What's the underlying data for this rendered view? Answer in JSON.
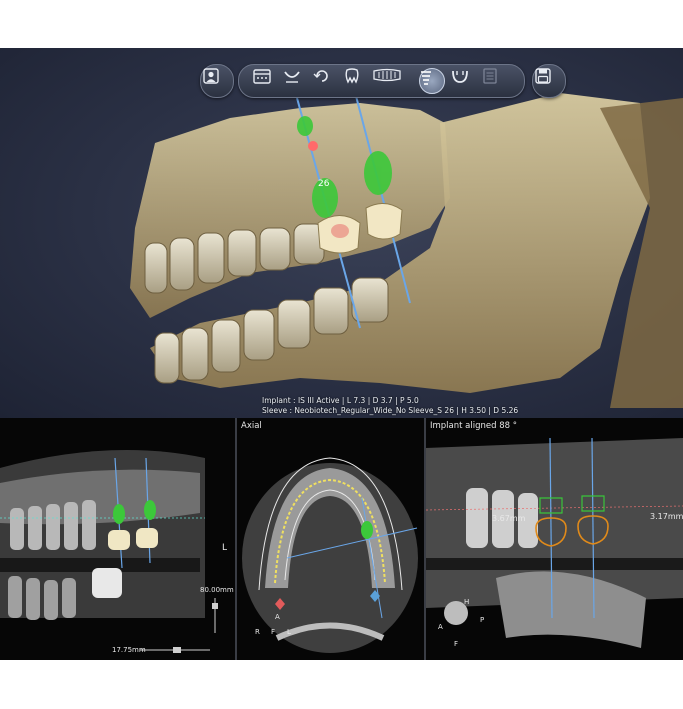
{
  "toolbar": {
    "groups": [
      {
        "name": "patient-group",
        "buttons": [
          {
            "icon": "patient-icon",
            "glyph": "👤"
          }
        ]
      },
      {
        "name": "tools-group",
        "buttons": [
          {
            "icon": "calendar-icon",
            "glyph": "▦"
          },
          {
            "icon": "arch-curve-icon",
            "glyph": "⌣"
          },
          {
            "icon": "rotate-icon",
            "glyph": "⟲"
          },
          {
            "icon": "tooth-icon",
            "glyph": "◌"
          },
          {
            "icon": "panoramic-icon",
            "glyph": "▭"
          },
          {
            "icon": "implant-icon",
            "glyph": "≡"
          },
          {
            "icon": "guide-icon",
            "glyph": "∪"
          },
          {
            "icon": "report-icon",
            "glyph": "▯"
          }
        ]
      },
      {
        "name": "save-group",
        "buttons": [
          {
            "icon": "save-icon",
            "glyph": "💾"
          }
        ]
      }
    ],
    "active": "implant-icon"
  },
  "view3d": {
    "implant_info": "Implant : IS III Active | L 7.3 | D 3.7 | P 5.0",
    "sleeve_info": "Sleeve : Neobiotech_Regular_Wide_No Sleeve_S 26 | H 3.50 | D 5.26",
    "tooth_label": "26"
  },
  "panels": {
    "left": {
      "orientation": "L",
      "depth_label": "80.00mm",
      "scale_label": "17.75mm"
    },
    "axial": {
      "title": "Axial",
      "labels": [
        "A",
        "R",
        "F",
        "L"
      ]
    },
    "cross": {
      "title": "Implant aligned 88 °",
      "left_measure": "3.67mm",
      "right_measure": "3.17mm",
      "labels": [
        "A",
        "H",
        "F",
        "P"
      ]
    }
  },
  "colors": {
    "bone": "#c9bb8e",
    "implant_green": "#39c43a",
    "axis_blue": "#6aa6e8",
    "guide_orange": "#e08a1a"
  }
}
